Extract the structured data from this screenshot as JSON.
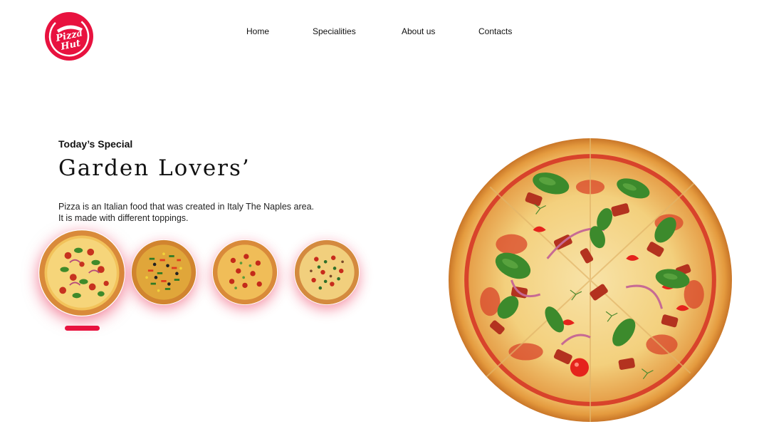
{
  "brand": {
    "logo_line1": "Pizza",
    "logo_line2": "Hut",
    "accent_color": "#e8123f"
  },
  "nav": {
    "items": [
      {
        "label": "Home"
      },
      {
        "label": "Specialities"
      },
      {
        "label": "About us"
      },
      {
        "label": "Contacts"
      }
    ]
  },
  "hero": {
    "subtitle": "Today’s Special",
    "title": "Garden Lovers’",
    "description": "Pizza is an Italian food that was created in Italy The Naples area. It is made with different toppings."
  },
  "carousel": {
    "thumbnails": [
      {
        "icon": "pizza-icon",
        "selected": true
      },
      {
        "icon": "pizza-icon",
        "selected": false
      },
      {
        "icon": "pizza-icon",
        "selected": false
      },
      {
        "icon": "pizza-icon",
        "selected": false
      }
    ],
    "active_index": 0
  },
  "featured_image": {
    "icon": "pizza-image"
  }
}
